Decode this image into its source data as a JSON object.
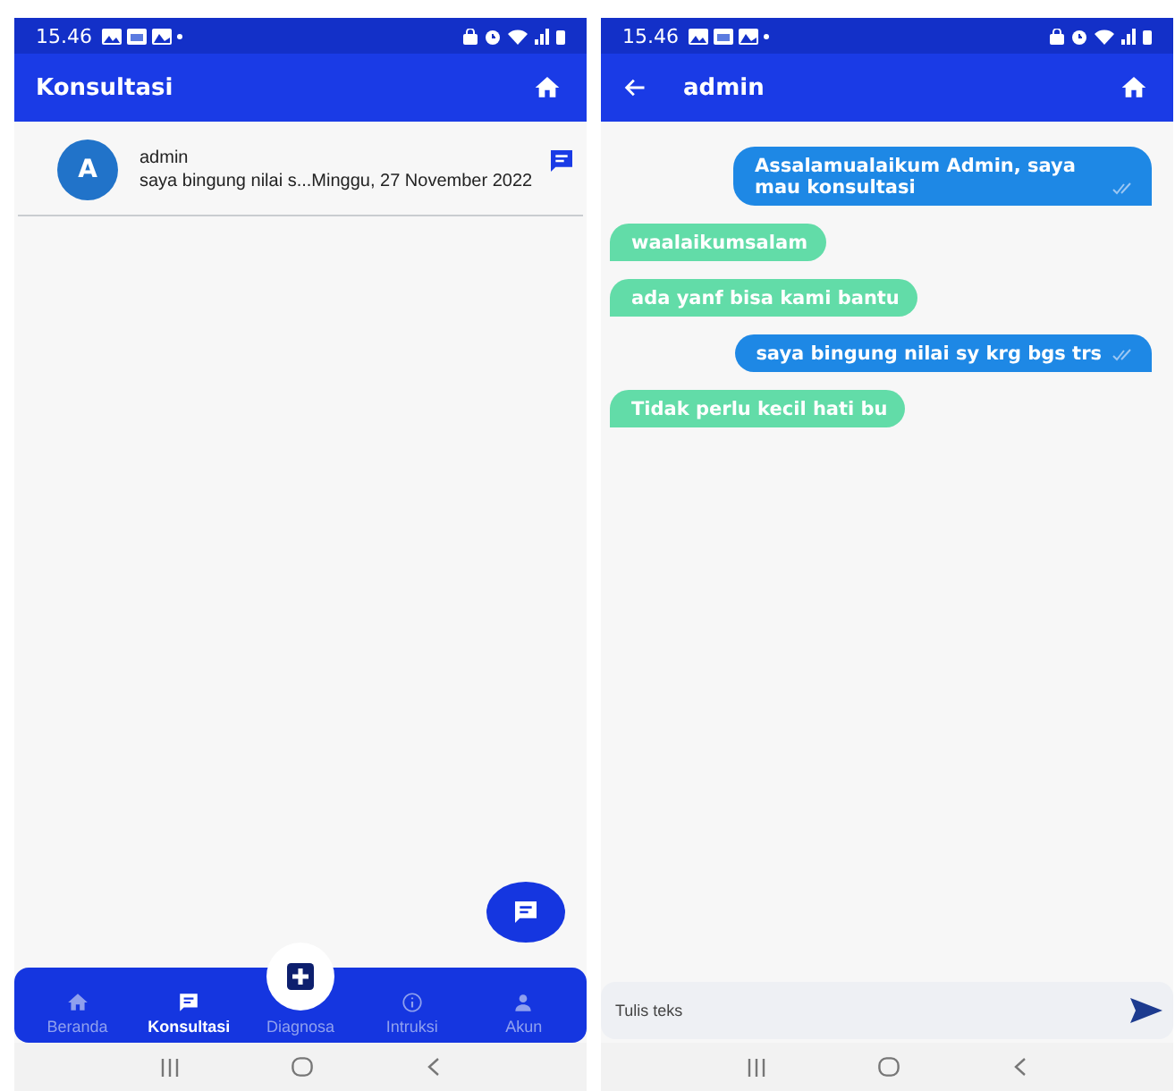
{
  "consultation_screen": {
    "status_bar": {
      "time": "15.46"
    },
    "app_bar": {
      "title": "Konsultasi"
    },
    "conversations": [
      {
        "avatar": "A",
        "name": "admin",
        "preview": "saya bingung nilai s...Minggu, 27 November 2022"
      }
    ],
    "bottom_nav": [
      {
        "label": "Beranda",
        "selected": false,
        "kind": "tab"
      },
      {
        "label": "Konsultasi",
        "selected": true,
        "kind": "tab"
      },
      {
        "label": "Diagnosa",
        "selected": false,
        "kind": "center"
      },
      {
        "label": "Intruksi",
        "selected": false,
        "kind": "tab"
      },
      {
        "label": "Akun",
        "selected": false,
        "kind": "tab"
      }
    ]
  },
  "chat_screen": {
    "status_bar": {
      "time": "15.46"
    },
    "app_bar": {
      "title": "admin"
    },
    "messages": [
      {
        "kind": "sent",
        "text": "Assalamualaikum Admin, saya mau konsultasi"
      },
      {
        "kind": "received",
        "text": "waalaikumsalam"
      },
      {
        "kind": "received",
        "text": "ada yanf bisa kami bantu"
      },
      {
        "kind": "sent",
        "text": "saya bingung nilai sy krg bgs trs"
      },
      {
        "kind": "received",
        "text": "Tidak perlu kecil hati bu"
      }
    ],
    "composer": {
      "placeholder": "Tulis teks"
    }
  }
}
